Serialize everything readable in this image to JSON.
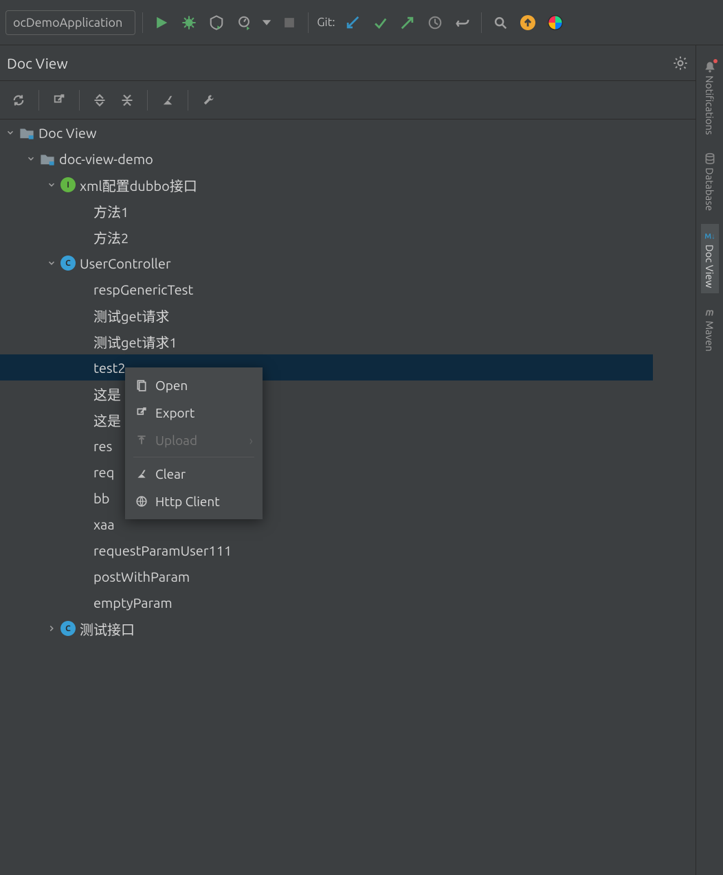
{
  "toolbar": {
    "run_config_label": "ocDemoApplication",
    "git_label": "Git:"
  },
  "panel": {
    "title": "Doc View"
  },
  "tree": {
    "root": "Doc View",
    "project": "doc-view-demo",
    "nodes": [
      {
        "label": "xml配置dubbo接口",
        "icon": "I",
        "iconClass": "i-green",
        "children": [
          "方法1",
          "方法2"
        ]
      },
      {
        "label": "UserController",
        "icon": "C",
        "iconClass": "i-cyan",
        "children": [
          "respGenericTest",
          "测试get请求",
          "测试get请求1",
          "test2",
          "这是",
          "这是                        测试换行",
          "res",
          "req                        count",
          "bb",
          "xaa",
          "requestParamUser111",
          "postWithParam",
          "emptyParam"
        ]
      },
      {
        "label": "测试接口",
        "icon": "C",
        "iconClass": "i-cyan",
        "children": [],
        "collapsed": true
      }
    ],
    "selected": "test2"
  },
  "context_menu": {
    "items": [
      {
        "label": "Open",
        "icon": "open"
      },
      {
        "label": "Export",
        "icon": "export"
      },
      {
        "label": "Upload",
        "icon": "upload",
        "disabled": true,
        "submenu": true
      },
      {
        "sep": true
      },
      {
        "label": "Clear",
        "icon": "clear"
      },
      {
        "label": "Http Client",
        "icon": "http"
      }
    ]
  },
  "right_bar": {
    "items": [
      {
        "label": "Notifications",
        "icon": "bell"
      },
      {
        "label": "Database",
        "icon": "db"
      },
      {
        "label": "Doc View",
        "icon": "md",
        "active": true
      },
      {
        "label": "Maven",
        "icon": "m"
      }
    ]
  }
}
